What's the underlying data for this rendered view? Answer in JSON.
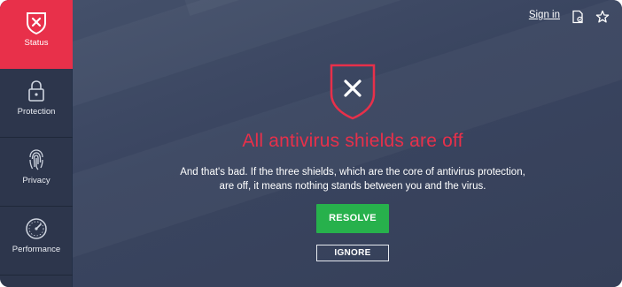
{
  "sidebar": {
    "items": [
      {
        "label": "Status",
        "icon": "shield-x-icon",
        "active": true
      },
      {
        "label": "Protection",
        "icon": "lock-icon",
        "active": false
      },
      {
        "label": "Privacy",
        "icon": "fingerprint-icon",
        "active": false
      },
      {
        "label": "Performance",
        "icon": "speedometer-icon",
        "active": false
      }
    ]
  },
  "topbar": {
    "signin_label": "Sign in",
    "icons": [
      "license-icon",
      "star-icon"
    ]
  },
  "status": {
    "icon": "shield-x-icon",
    "headline": "All antivirus shields are off",
    "description": "And that's bad. If the three shields, which are the core of antivirus protection, are off, it means nothing stands between you and the virus.",
    "resolve_label": "RESOLVE",
    "ignore_label": "IGNORE"
  },
  "colors": {
    "accent_red": "#e8304a",
    "resolve_green": "#27b14c",
    "sidebar_bg": "#2d364c",
    "main_bg": "#3b4660"
  }
}
